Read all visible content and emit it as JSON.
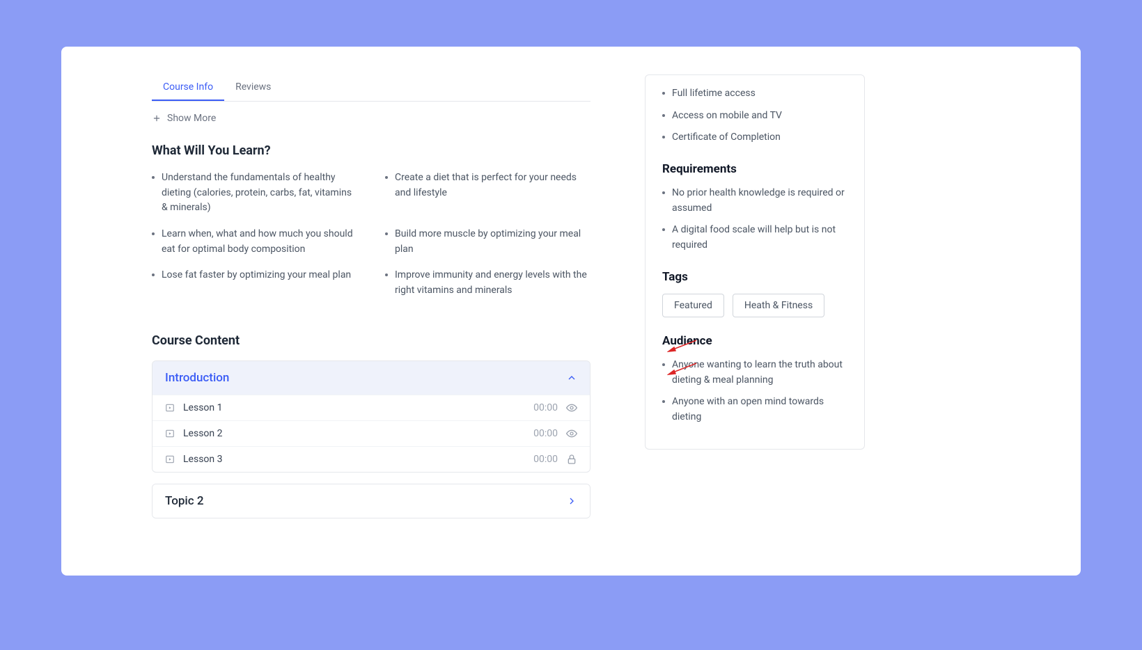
{
  "tabs": [
    {
      "label": "Course Info",
      "active": true
    },
    {
      "label": "Reviews",
      "active": false
    }
  ],
  "showMore": "Show More",
  "sections": {
    "learn": {
      "title": "What Will You Learn?",
      "items": [
        "Understand the fundamentals of healthy dieting (calories, protein, carbs, fat, vitamins & minerals)",
        "Create a diet that is perfect for your needs and lifestyle",
        "Learn when, what and how much you should eat for optimal body composition",
        "Build more muscle by optimizing your meal plan",
        "Lose fat faster by optimizing your meal plan",
        "Improve immunity and energy levels with the right vitamins and minerals"
      ]
    },
    "content": {
      "title": "Course Content",
      "topics": [
        {
          "title": "Introduction",
          "expanded": true,
          "lessons": [
            {
              "title": "Lesson 1",
              "time": "00:00",
              "status": "preview"
            },
            {
              "title": "Lesson 2",
              "time": "00:00",
              "status": "preview"
            },
            {
              "title": "Lesson 3",
              "time": "00:00",
              "status": "locked"
            }
          ]
        },
        {
          "title": "Topic 2",
          "expanded": false,
          "lessons": []
        }
      ]
    }
  },
  "sidebar": {
    "features": [
      "Full lifetime access",
      "Access on mobile and TV",
      "Certificate of Completion"
    ],
    "requirements": {
      "title": "Requirements",
      "items": [
        "No prior health knowledge is required or assumed",
        "A digital food scale will help but is not required"
      ]
    },
    "tags": {
      "title": "Tags",
      "items": [
        "Featured",
        "Heath & Fitness"
      ]
    },
    "audience": {
      "title": "Audience",
      "items": [
        "Anyone wanting to learn the truth about dieting & meal planning",
        "Anyone with an open mind towards dieting"
      ]
    }
  }
}
